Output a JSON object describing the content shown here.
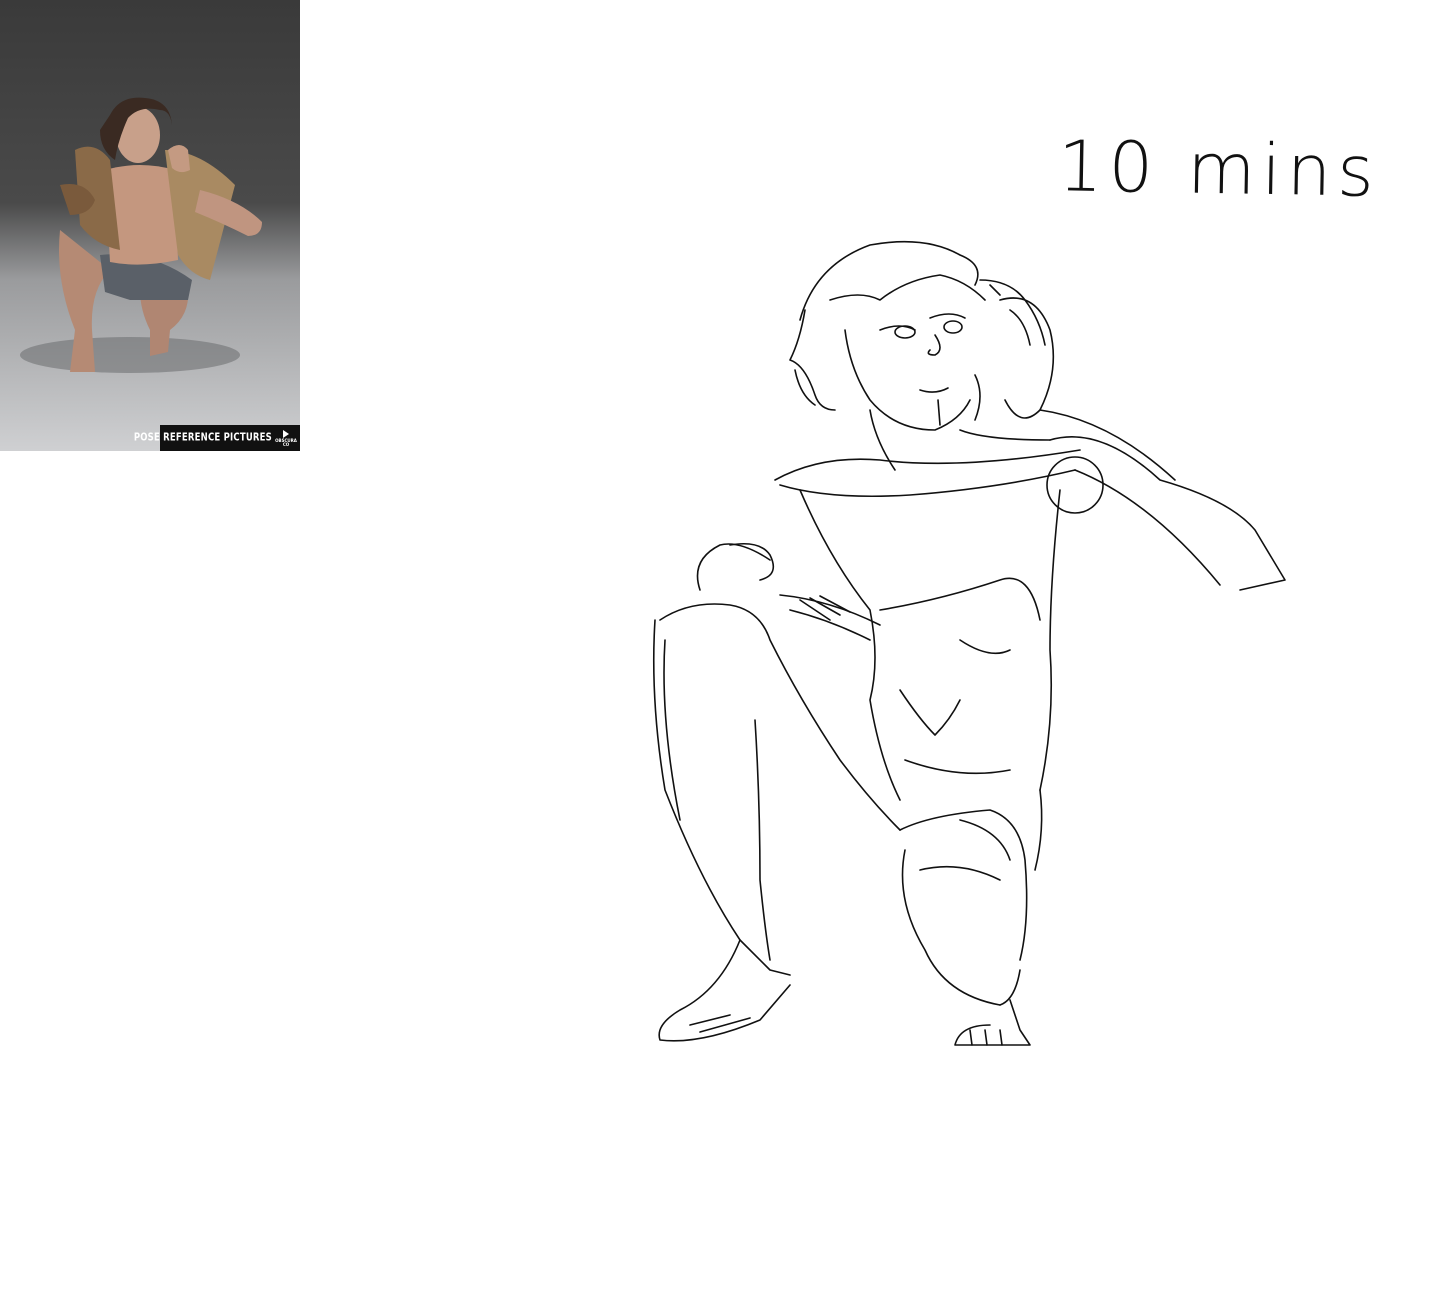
{
  "reference": {
    "banner_text": "POSE REFERENCE PICTURES",
    "logo_top": "OBSCURA",
    "logo_bottom": "CO"
  },
  "annotation": {
    "timer": "10 mins"
  }
}
